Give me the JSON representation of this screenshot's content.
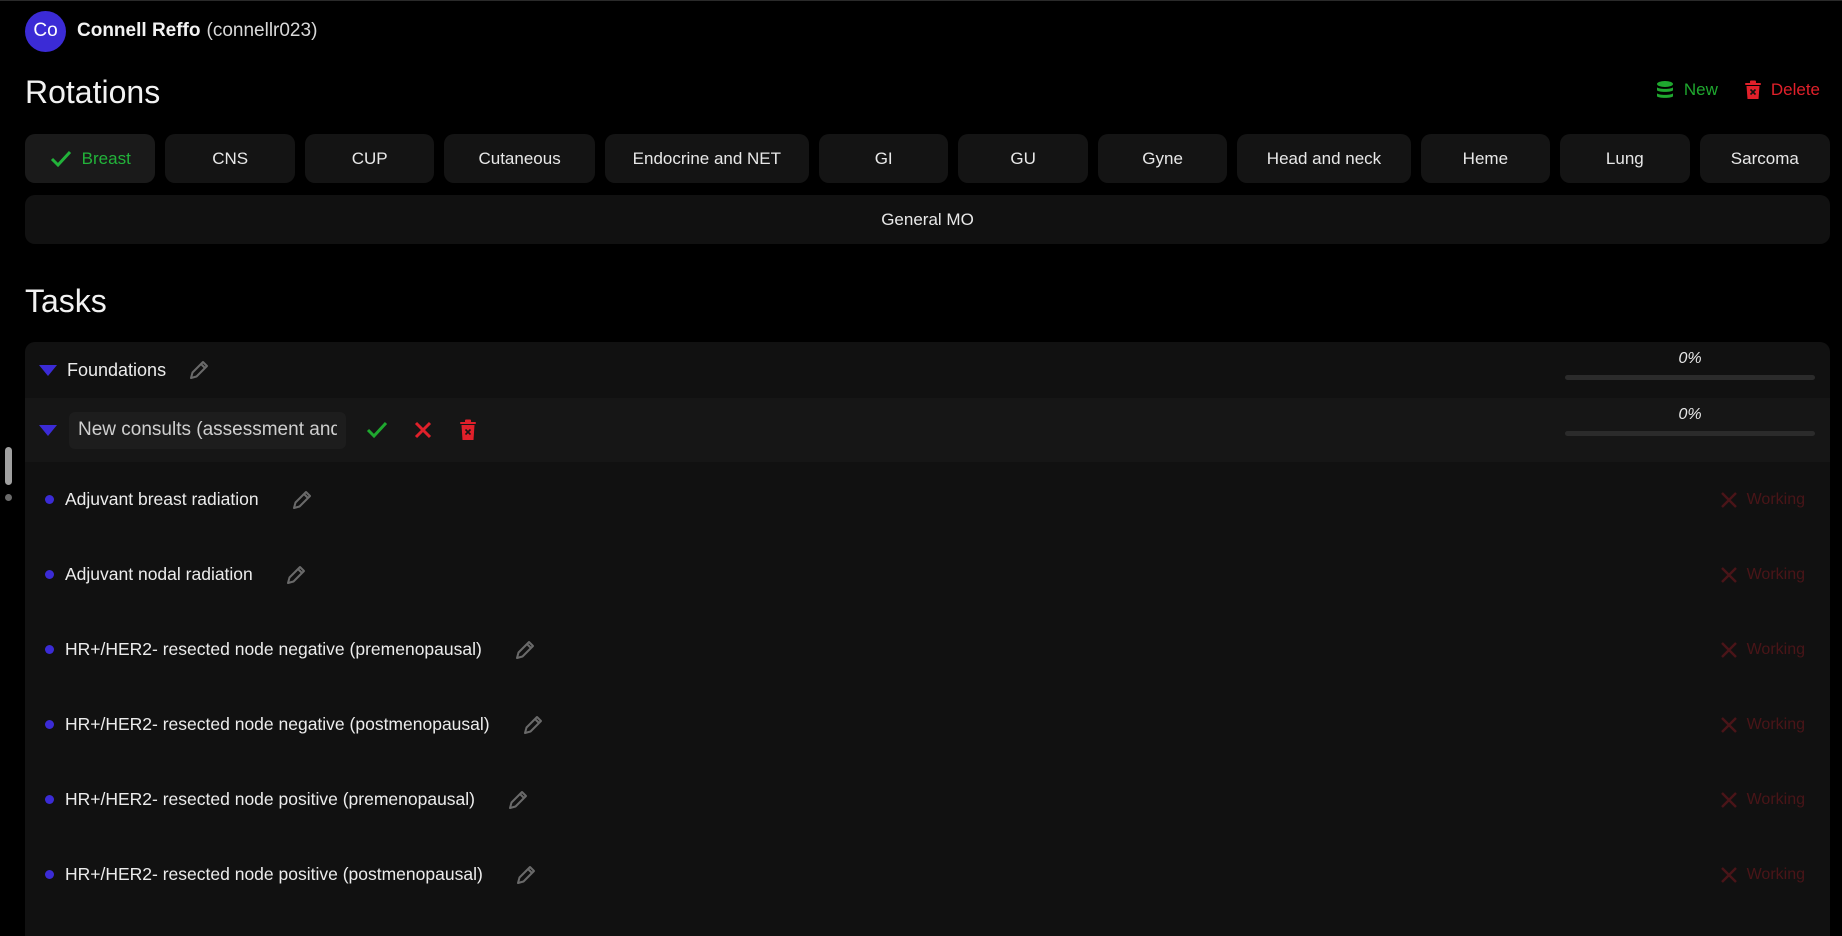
{
  "user": {
    "initials": "Co",
    "name": "Connell Reffo",
    "handle": "(connellr023)"
  },
  "rotations": {
    "title": "Rotations",
    "new_label": "New",
    "delete_label": "Delete",
    "items": [
      {
        "label": "Breast",
        "selected": true
      },
      {
        "label": "CNS"
      },
      {
        "label": "CUP"
      },
      {
        "label": "Cutaneous"
      },
      {
        "label": "Endocrine and NET"
      },
      {
        "label": "GI"
      },
      {
        "label": "GU"
      },
      {
        "label": "Gyne"
      },
      {
        "label": "Head and neck"
      },
      {
        "label": "Heme"
      },
      {
        "label": "Lung"
      },
      {
        "label": "Sarcoma"
      }
    ],
    "general": "General MO"
  },
  "tasks": {
    "title": "Tasks",
    "groups": [
      {
        "label": "Foundations",
        "progress": "0%",
        "progress_value": 0
      },
      {
        "edit_value": "New consults (assessment and plan)",
        "progress": "0%",
        "progress_value": 0
      }
    ],
    "items": [
      {
        "label": "Adjuvant breast radiation",
        "status": "Working"
      },
      {
        "label": "Adjuvant nodal radiation",
        "status": "Working"
      },
      {
        "label": "HR+/HER2- resected node negative (premenopausal)",
        "status": "Working"
      },
      {
        "label": "HR+/HER2- resected node negative (postmenopausal)",
        "status": "Working"
      },
      {
        "label": "HR+/HER2- resected node positive (premenopausal)",
        "status": "Working"
      },
      {
        "label": "HR+/HER2- resected node positive (postmenopausal)",
        "status": "Working"
      }
    ]
  },
  "colors": {
    "accent": "#3b2bd6",
    "success": "#1fa82f",
    "danger": "#e0202a",
    "status_dim": "#4a1518"
  },
  "icons": {
    "check": "check-icon",
    "pencil": "pencil-icon",
    "close": "close-icon",
    "trash": "trash-icon",
    "database": "database-icon",
    "triangle": "triangle-down-icon"
  }
}
